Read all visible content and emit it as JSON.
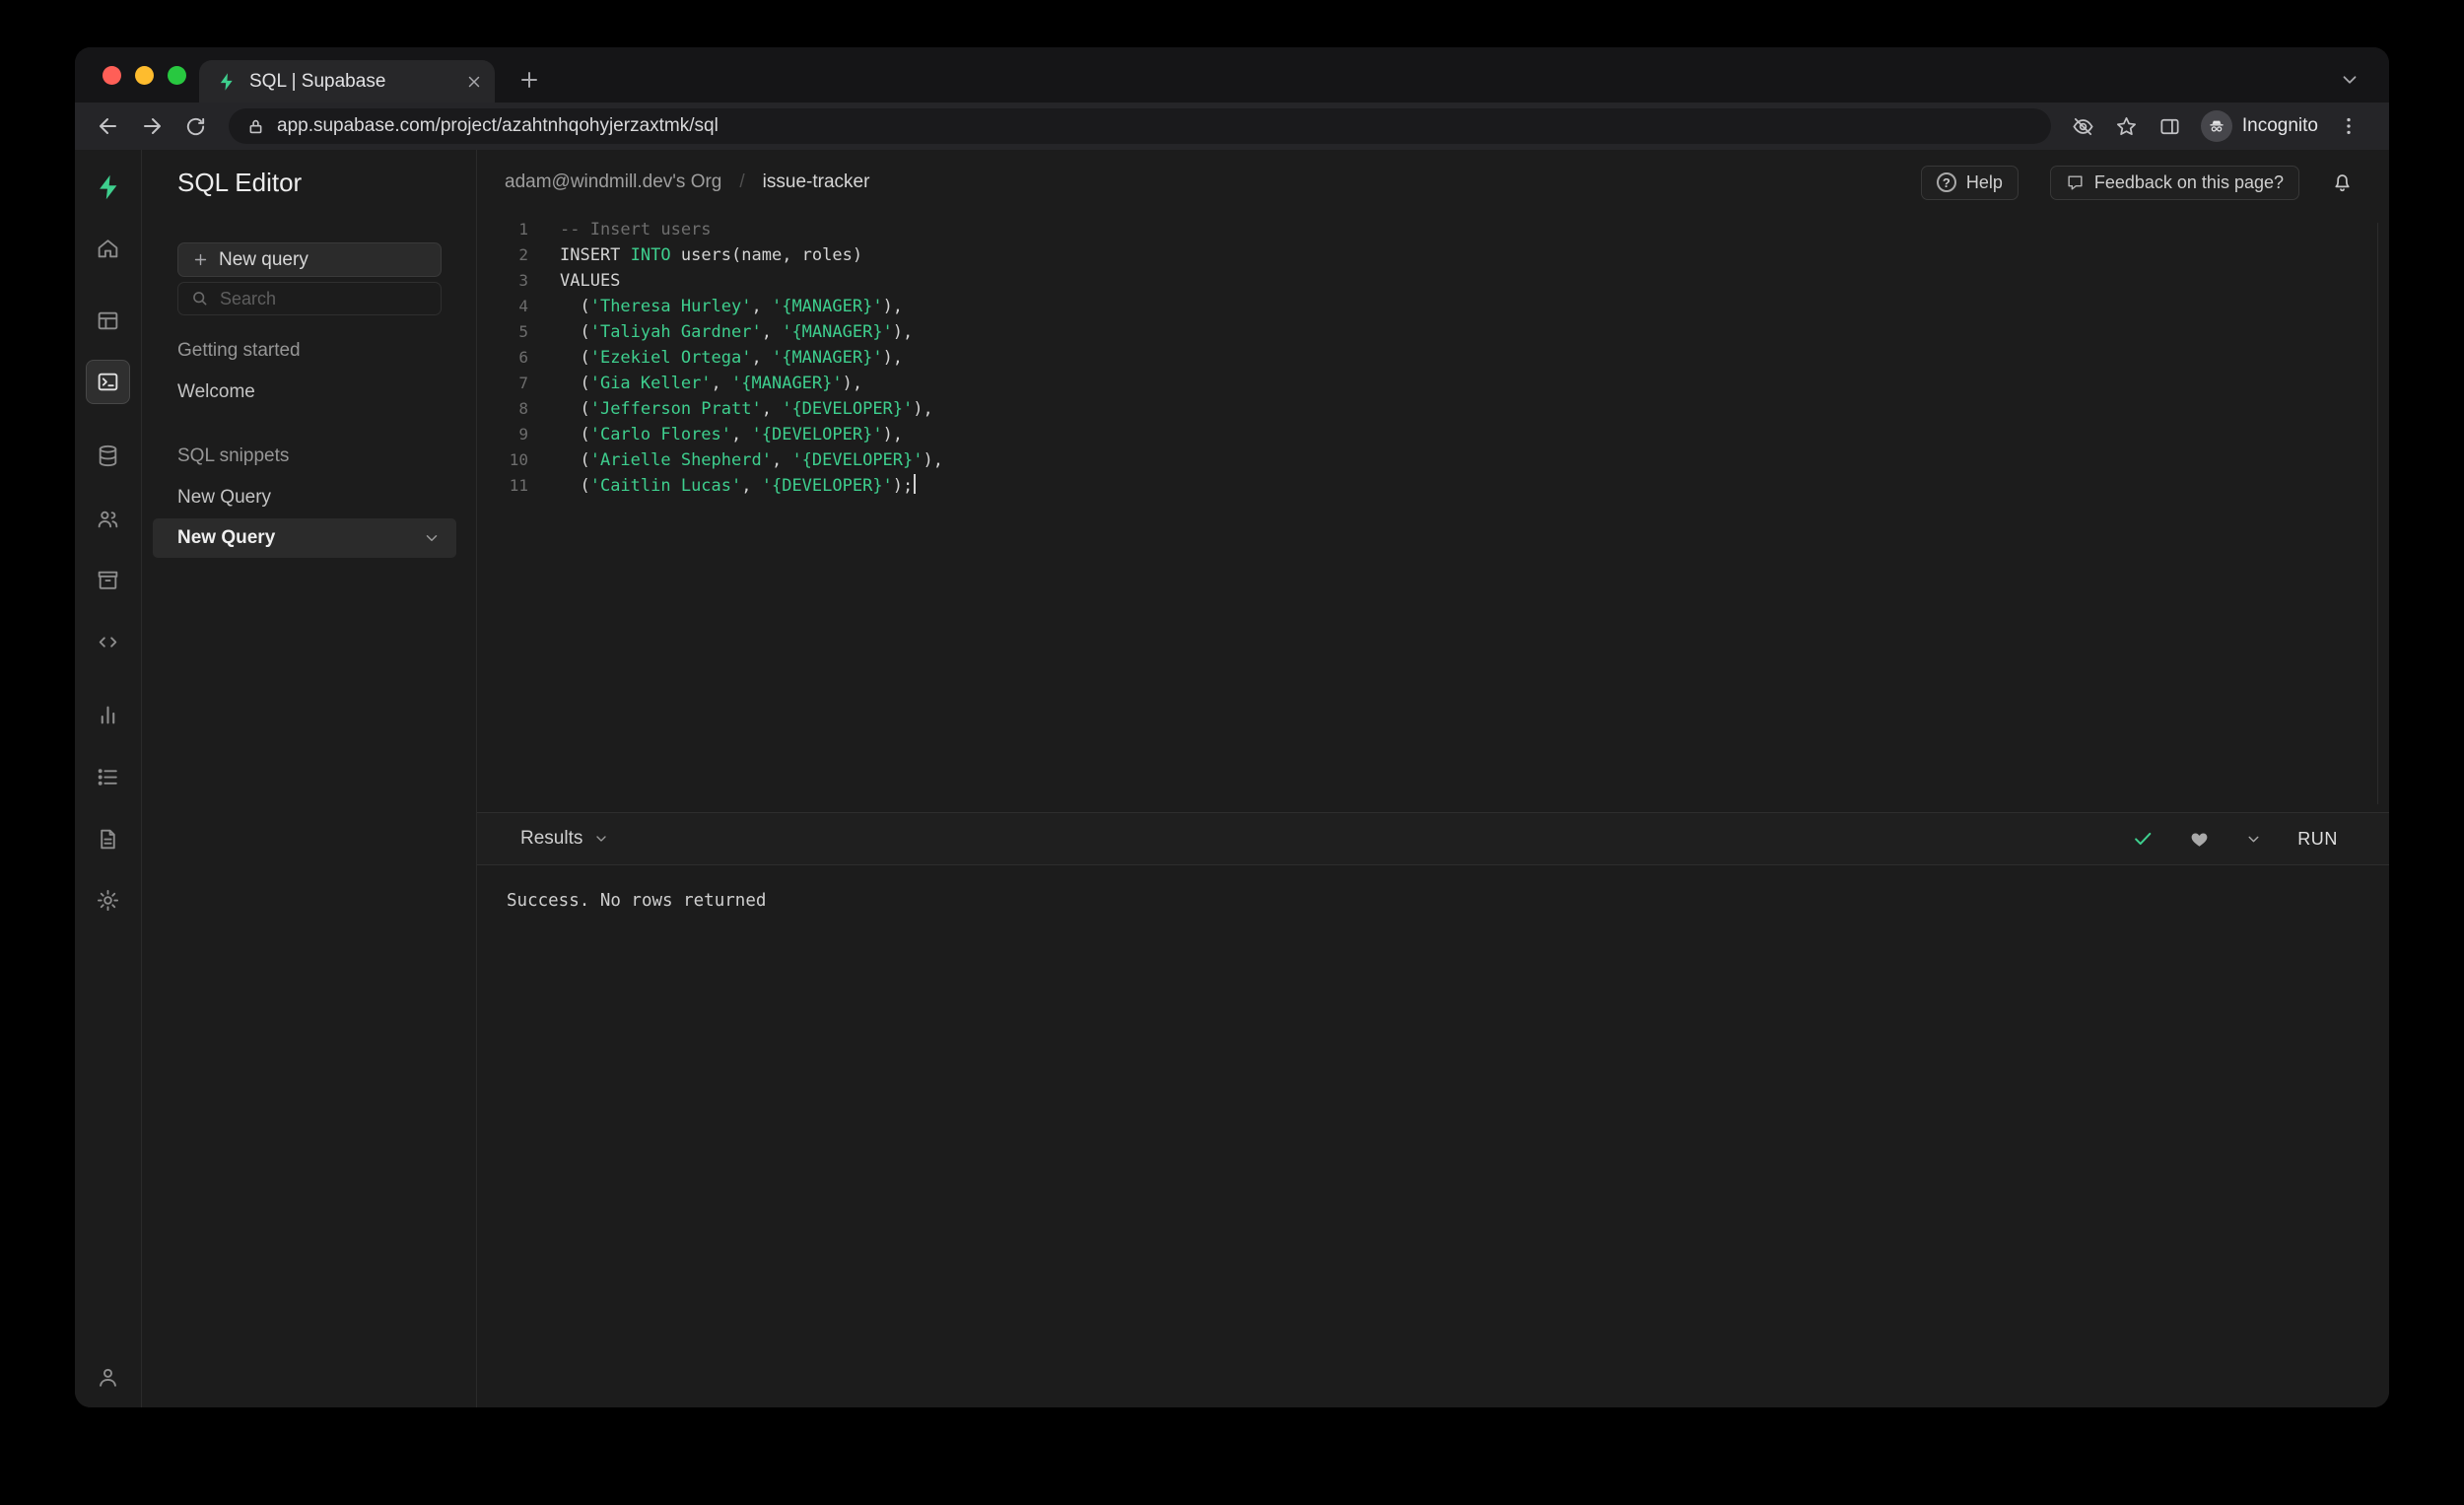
{
  "colors": {
    "accent_green": "#3ecf8e"
  },
  "browser": {
    "tab_title": "SQL | Supabase",
    "url": "app.supabase.com/project/azahtnhqohyjerzaxtmk/sql",
    "incognito_label": "Incognito"
  },
  "sidebar": {
    "title": "SQL Editor",
    "new_query_button": "New query",
    "search_placeholder": "Search",
    "sections": [
      {
        "label": "Getting started",
        "items": [
          "Welcome"
        ]
      },
      {
        "label": "SQL snippets",
        "items": [
          "New Query"
        ]
      }
    ],
    "selected_item": "New Query"
  },
  "header": {
    "org": "adam@windmill.dev's Org",
    "separator": "/",
    "project": "issue-tracker",
    "help": "Help",
    "help_icon": "?",
    "feedback": "Feedback on this page?"
  },
  "editor": {
    "token_colors": {
      "plain": "#d4d4d4",
      "keyword": "#3ecf8e",
      "string": "#3ecf8e",
      "comment": "#6e6e6e"
    },
    "lines": [
      [
        [
          "-- Insert users",
          "comment"
        ]
      ],
      [
        [
          "INSERT ",
          "plain"
        ],
        [
          "INTO",
          "keyword"
        ],
        [
          " users(name, roles)",
          "plain"
        ]
      ],
      [
        [
          "VALUES",
          "plain"
        ]
      ],
      [
        [
          "  (",
          "plain"
        ],
        [
          "'Theresa Hurley'",
          "string"
        ],
        [
          ", ",
          "plain"
        ],
        [
          "'{MANAGER}'",
          "string"
        ],
        [
          "),",
          "plain"
        ]
      ],
      [
        [
          "  (",
          "plain"
        ],
        [
          "'Taliyah Gardner'",
          "string"
        ],
        [
          ", ",
          "plain"
        ],
        [
          "'{MANAGER}'",
          "string"
        ],
        [
          "),",
          "plain"
        ]
      ],
      [
        [
          "  (",
          "plain"
        ],
        [
          "'Ezekiel Ortega'",
          "string"
        ],
        [
          ", ",
          "plain"
        ],
        [
          "'{MANAGER}'",
          "string"
        ],
        [
          "),",
          "plain"
        ]
      ],
      [
        [
          "  (",
          "plain"
        ],
        [
          "'Gia Keller'",
          "string"
        ],
        [
          ", ",
          "plain"
        ],
        [
          "'{MANAGER}'",
          "string"
        ],
        [
          "),",
          "plain"
        ]
      ],
      [
        [
          "  (",
          "plain"
        ],
        [
          "'Jefferson Pratt'",
          "string"
        ],
        [
          ", ",
          "plain"
        ],
        [
          "'{DEVELOPER}'",
          "string"
        ],
        [
          "),",
          "plain"
        ]
      ],
      [
        [
          "  (",
          "plain"
        ],
        [
          "'Carlo Flores'",
          "string"
        ],
        [
          ", ",
          "plain"
        ],
        [
          "'{DEVELOPER}'",
          "string"
        ],
        [
          "),",
          "plain"
        ]
      ],
      [
        [
          "  (",
          "plain"
        ],
        [
          "'Arielle Shepherd'",
          "string"
        ],
        [
          ", ",
          "plain"
        ],
        [
          "'{DEVELOPER}'",
          "string"
        ],
        [
          "),",
          "plain"
        ]
      ],
      [
        [
          "  (",
          "plain"
        ],
        [
          "'Caitlin Lucas'",
          "string"
        ],
        [
          ", ",
          "plain"
        ],
        [
          "'{DEVELOPER}'",
          "string"
        ],
        [
          ");",
          "plain"
        ]
      ]
    ]
  },
  "results": {
    "label": "Results",
    "run": "RUN",
    "message": "Success. No rows returned"
  }
}
